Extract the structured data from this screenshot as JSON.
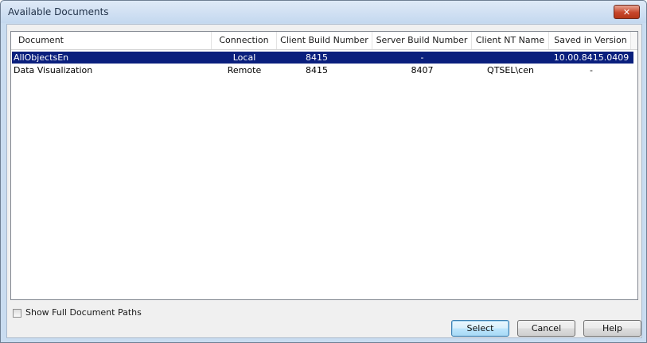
{
  "window": {
    "title": "Available Documents",
    "close_label": "✕"
  },
  "table": {
    "columns": [
      "Document",
      "Connection",
      "Client Build Number",
      "Server Build Number",
      "Client NT Name",
      "Saved in Version"
    ],
    "rows": [
      {
        "document": "AllObjectsEn",
        "connection": "Local",
        "client_build": "8415",
        "server_build": "-",
        "client_nt_name": "",
        "saved_version": "10.00.8415.0409",
        "selected": true
      },
      {
        "document": "Data Visualization",
        "connection": "Remote",
        "client_build": "8415",
        "server_build": "8407",
        "client_nt_name": "QTSEL\\cen",
        "saved_version": "-",
        "selected": false
      }
    ]
  },
  "options": {
    "show_full_paths_label": "Show Full Document Paths",
    "show_full_paths_checked": false
  },
  "buttons": {
    "select": "Select",
    "cancel": "Cancel",
    "help": "Help"
  }
}
